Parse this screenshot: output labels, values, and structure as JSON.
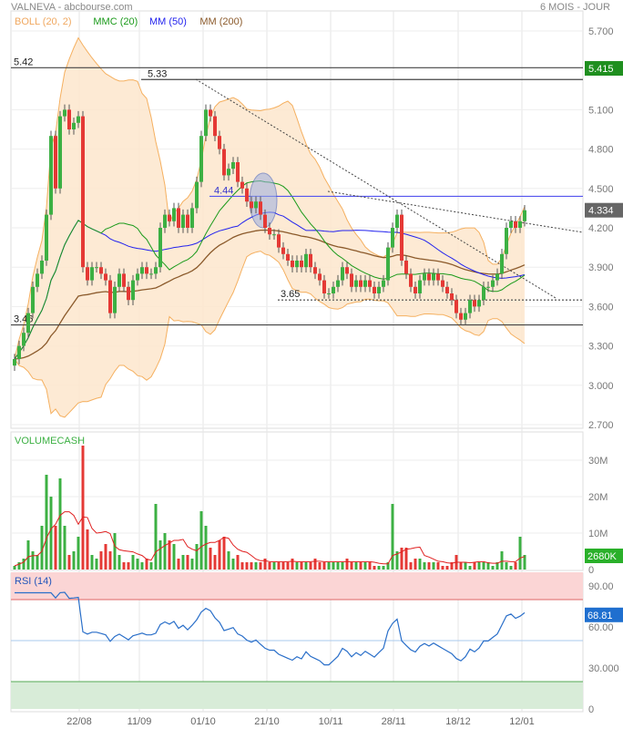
{
  "header": {
    "title": "VALNEVA - abcbourse.com",
    "period": "6 MOIS - JOUR"
  },
  "legend": [
    {
      "label": "BOLL (20, 2)",
      "color": "#f0a860"
    },
    {
      "label": "MMC (20)",
      "color": "#1a9a1a"
    },
    {
      "label": "MM (50)",
      "color": "#2222ee"
    },
    {
      "label": "MM (200)",
      "color": "#8b5a2b"
    }
  ],
  "chart_data": {
    "type": "candlestick",
    "x_tick_labels": [
      "22/08",
      "11/09",
      "01/10",
      "21/10",
      "10/11",
      "28/11",
      "18/12",
      "12/01"
    ],
    "price_axis": {
      "ylim": [
        2.7,
        5.85
      ],
      "ticks": [
        "5.700",
        "5.100",
        "4.800",
        "4.500",
        "4.200",
        "3.900",
        "3.600",
        "3.300",
        "3.000",
        "2.700"
      ]
    },
    "closes": [
      3.2,
      3.3,
      3.4,
      3.55,
      3.75,
      3.85,
      3.95,
      4.3,
      4.9,
      4.5,
      5.05,
      5.1,
      4.95,
      5.0,
      5.05,
      3.9,
      3.8,
      3.9,
      3.9,
      3.85,
      3.8,
      3.55,
      3.75,
      3.85,
      3.75,
      3.65,
      3.8,
      3.85,
      3.9,
      3.85,
      3.85,
      3.9,
      4.2,
      4.3,
      4.25,
      4.35,
      4.2,
      4.3,
      4.2,
      4.35,
      4.55,
      4.9,
      5.1,
      5.05,
      4.9,
      4.8,
      4.6,
      4.65,
      4.7,
      4.55,
      4.5,
      4.4,
      4.35,
      4.4,
      4.3,
      4.2,
      4.15,
      4.15,
      4.05,
      4.0,
      3.95,
      3.9,
      3.95,
      3.9,
      4.0,
      3.9,
      3.85,
      3.8,
      3.7,
      3.7,
      3.75,
      3.8,
      3.9,
      3.85,
      3.75,
      3.8,
      3.75,
      3.8,
      3.75,
      3.7,
      3.75,
      3.8,
      4.05,
      4.2,
      4.3,
      3.95,
      3.85,
      3.75,
      3.7,
      3.8,
      3.85,
      3.8,
      3.85,
      3.8,
      3.75,
      3.7,
      3.65,
      3.55,
      3.5,
      3.55,
      3.65,
      3.6,
      3.65,
      3.75,
      3.75,
      3.8,
      3.85,
      4.0,
      4.2,
      4.25,
      4.2,
      4.25,
      4.334
    ],
    "volume_M": [
      1,
      2,
      3,
      8,
      5,
      4,
      12,
      26,
      20,
      12,
      25,
      12,
      4,
      5,
      9,
      34,
      11,
      4,
      3,
      5,
      7,
      5,
      10,
      4,
      2,
      2,
      4,
      3,
      2,
      3,
      2,
      18,
      8,
      10,
      8,
      7,
      3,
      4,
      4,
      3,
      7,
      16,
      12,
      6,
      4,
      8,
      9,
      5,
      3,
      4,
      2,
      2,
      2,
      2,
      2,
      3,
      2,
      2,
      2,
      2,
      2,
      3,
      2,
      2,
      2,
      2,
      3,
      2,
      2,
      2,
      2,
      2,
      2,
      3,
      2,
      2,
      2,
      2,
      2,
      1,
      1,
      1,
      2,
      18,
      5,
      6,
      6,
      2,
      3,
      3,
      2,
      2,
      2,
      2,
      1,
      1,
      2,
      4,
      2,
      2,
      1,
      2,
      2,
      2,
      2,
      1,
      2,
      5,
      2,
      1,
      2,
      9,
      4,
      5,
      2,
      2,
      3
    ],
    "volume_axis": {
      "label": "VOLUMECASH",
      "ticks": [
        "30M",
        "20M",
        "10M",
        "0"
      ]
    },
    "rsi_axis": {
      "label": "RSI (14)",
      "ticks": [
        "90.00",
        "60.00",
        "30.000",
        "0"
      ],
      "overbought": 80,
      "oversold": 20
    },
    "levels": [
      {
        "label": "5.42",
        "value": 5.42
      },
      {
        "label": "5.33",
        "value": 5.33
      },
      {
        "label": "4.44",
        "value": 4.44
      },
      {
        "label": "3.65",
        "value": 3.65
      },
      {
        "label": "3.46",
        "value": 3.46
      }
    ],
    "last": {
      "price": "4.334",
      "high_marker": "5.415",
      "volume": "2680K",
      "rsi": "68.81"
    }
  }
}
